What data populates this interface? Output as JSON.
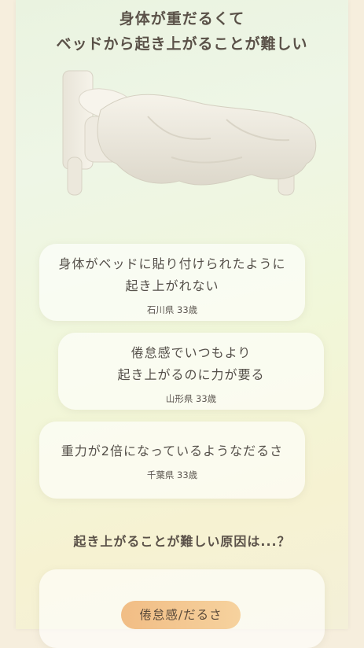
{
  "headline": {
    "line1": "身体が重だるくて",
    "line2": "ベッドから起き上がることが難しい"
  },
  "testimonials": [
    {
      "line1": "身体がベッドに貼り付けられたように",
      "line2": "起き上がれない",
      "meta": "石川県 33歳"
    },
    {
      "line1": "倦怠感でいつもより",
      "line2": "起き上がるのに力が要る",
      "meta": "山形県 33歳"
    },
    {
      "line1": "重力が2倍になっているようなだるさ",
      "meta": "千葉県 33歳"
    }
  ],
  "question": "起き上がることが難しい原因は...？",
  "cause_pill": "倦怠感/だるさ",
  "colors": {
    "pill_start": "#f1bd85",
    "pill_end": "#f6d29e",
    "text": "#5a5148"
  }
}
